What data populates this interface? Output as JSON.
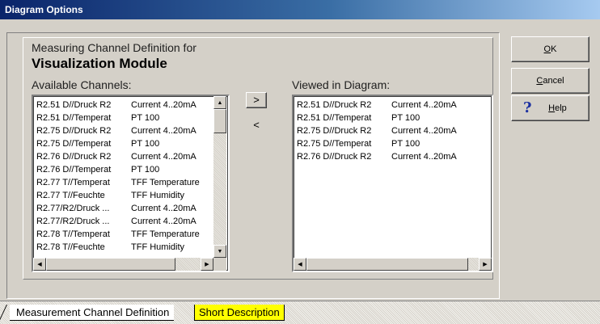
{
  "window": {
    "title": "Diagram Options"
  },
  "heading": {
    "line": "Measuring Channel Definition for",
    "title": "Visualization Module"
  },
  "available": {
    "label": "Available Channels:",
    "rows": [
      [
        "R2.51 D//Druck R2",
        "Current 4..20mA"
      ],
      [
        "R2.51 D//Temperat",
        "PT 100"
      ],
      [
        "R2.75 D//Druck R2",
        "Current 4..20mA"
      ],
      [
        "R2.75 D//Temperat",
        "PT 100"
      ],
      [
        "R2.76 D//Druck R2",
        "Current 4..20mA"
      ],
      [
        "R2.76 D//Temperat",
        "PT 100"
      ],
      [
        "R2.77 T//Temperat",
        "TFF Temperature"
      ],
      [
        "R2.77 T//Feuchte",
        "TFF Humidity"
      ],
      [
        "R2.77/R2/Druck ...",
        "Current 4..20mA"
      ],
      [
        "R2.77/R2/Druck ...",
        "Current 4..20mA"
      ],
      [
        "R2.78 T//Temperat",
        "TFF Temperature"
      ],
      [
        "R2.78 T//Feuchte",
        "TFF Humidity"
      ]
    ]
  },
  "viewed": {
    "label": "Viewed in Diagram:",
    "rows": [
      [
        "R2.51 D//Druck R2",
        "Current 4..20mA"
      ],
      [
        "R2.51 D//Temperat",
        "PT 100"
      ],
      [
        "R2.75 D//Druck R2",
        "Current 4..20mA"
      ],
      [
        "R2.75 D//Temperat",
        "PT 100"
      ],
      [
        "R2.76 D//Druck R2",
        "Current 4..20mA"
      ]
    ]
  },
  "move": {
    "add": ">",
    "remove": "<"
  },
  "buttons": {
    "ok_first": "O",
    "ok_rest": "K",
    "cancel_first": "C",
    "cancel_rest": "ancel",
    "help_first": "H",
    "help_rest": "elp",
    "help_glyph": "?"
  },
  "tabs": {
    "definition": "Measurement Channel Definition",
    "description": "Short Description"
  },
  "scroll_glyphs": {
    "up": "▲",
    "down": "▼",
    "left": "◀",
    "right": "▶"
  },
  "colors": {
    "title_bar": "#0a246a",
    "active_tab": "#ffff00",
    "help_icon": "#1a2ea0"
  }
}
